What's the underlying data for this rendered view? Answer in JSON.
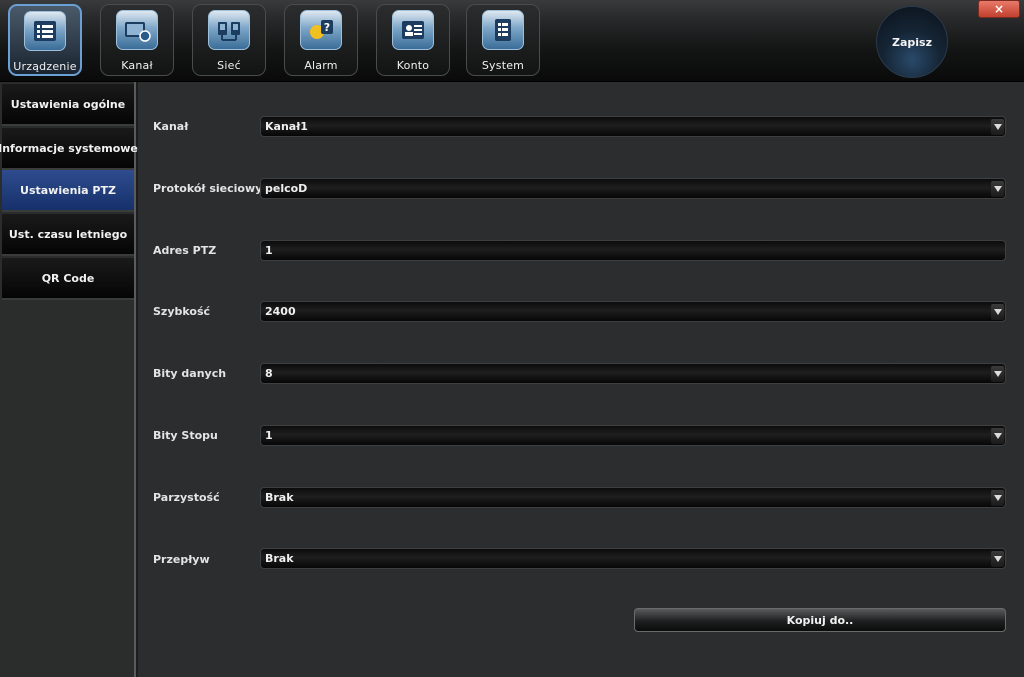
{
  "window": {
    "close_label": "×",
    "save_label": "Zapisz"
  },
  "tabs": [
    {
      "label": "Urządzenie",
      "icon": "device-list-icon",
      "active": true
    },
    {
      "label": "Kanał",
      "icon": "channel-camera-icon",
      "active": false
    },
    {
      "label": "Sieć",
      "icon": "network-icon",
      "active": false
    },
    {
      "label": "Alarm",
      "icon": "alarm-icon",
      "active": false
    },
    {
      "label": "Konto",
      "icon": "account-icon",
      "active": false
    },
    {
      "label": "System",
      "icon": "system-icon",
      "active": false
    }
  ],
  "sidebar": {
    "items": [
      {
        "label": "Ustawienia ogólne",
        "active": false
      },
      {
        "label": "Informacje systemowe",
        "active": false
      },
      {
        "label": "Ustawienia PTZ",
        "active": true
      },
      {
        "label": "Ust. czasu letniego",
        "active": false
      },
      {
        "label": "QR Code",
        "active": false
      }
    ]
  },
  "form": {
    "rows": [
      {
        "label": "Kanał",
        "value": "Kanał1",
        "type": "select"
      },
      {
        "label": "Protokół sieciowy",
        "value": "pelcoD",
        "type": "select"
      },
      {
        "label": "Adres PTZ",
        "value": "1",
        "type": "input"
      },
      {
        "label": "Szybkość",
        "value": "2400",
        "type": "select"
      },
      {
        "label": "Bity danych",
        "value": "8",
        "type": "select"
      },
      {
        "label": "Bity Stopu",
        "value": "1",
        "type": "select"
      },
      {
        "label": "Parzystość",
        "value": "Brak",
        "type": "select"
      },
      {
        "label": "Przepływ",
        "value": "Brak",
        "type": "select"
      }
    ],
    "copy_label": "Kopiuj do.."
  },
  "colors": {
    "accent": "#6aa0d4",
    "sidebar_active": "#2e4c8e",
    "close_red": "#c2402e"
  }
}
